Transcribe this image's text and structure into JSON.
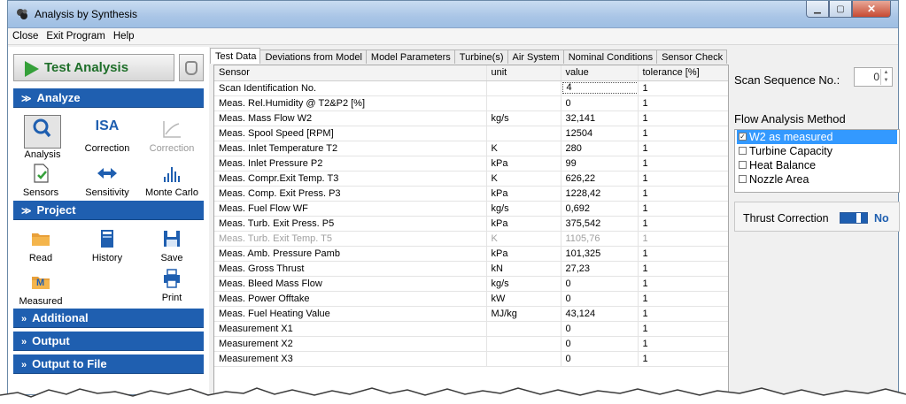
{
  "window": {
    "title": "Analysis by Synthesis",
    "controls": [
      "minimize",
      "maximize",
      "close"
    ]
  },
  "menu": [
    "Close",
    "Exit Program",
    "Help"
  ],
  "sidebar": {
    "run_button_label": "Test Analysis",
    "sections": {
      "analyze": "Analyze",
      "project": "Project",
      "additional": "Additional",
      "output": "Output",
      "output_file": "Output to File"
    },
    "analyze_tools": [
      {
        "label": "Analysis",
        "icon": "search-icon",
        "enabled": true,
        "selected": true
      },
      {
        "label": "Correction",
        "icon": "isa-icon",
        "icon_text": "ISA",
        "enabled": true
      },
      {
        "label": "Correction",
        "icon": "curve-icon",
        "enabled": false
      },
      {
        "label": "Sensors",
        "icon": "document-check-icon",
        "enabled": true
      },
      {
        "label": "Sensitivity",
        "icon": "double-arrow-icon",
        "enabled": true
      },
      {
        "label": "Monte Carlo",
        "icon": "histogram-icon",
        "enabled": true
      }
    ],
    "project_tools": [
      {
        "label": "Read",
        "icon": "folder-icon"
      },
      {
        "label": "History",
        "icon": "book-icon"
      },
      {
        "label": "Save",
        "icon": "floppy-icon"
      },
      {
        "label": "Measured",
        "icon": "measured-folder-icon",
        "icon_text": "M"
      },
      {
        "label": "Print",
        "icon": "printer-icon"
      }
    ]
  },
  "tabs": [
    "Test Data",
    "Deviations from Model",
    "Model Parameters",
    "Turbine(s)",
    "Air System",
    "Nominal Conditions",
    "Sensor Check"
  ],
  "active_tab": "Test Data",
  "table": {
    "headers": [
      "Sensor",
      "unit",
      "value",
      "tolerance [%]"
    ],
    "rows": [
      [
        "Scan Identification No.",
        "",
        "4",
        "1"
      ],
      [
        "Meas. Rel.Humidity @ T2&P2 [%]",
        "",
        "0",
        "1"
      ],
      [
        "Meas. Mass Flow W2",
        "kg/s",
        "32,141",
        "1"
      ],
      [
        "Meas. Spool Speed [RPM]",
        "",
        "12504",
        "1"
      ],
      [
        "Meas. Inlet Temperature T2",
        "K",
        "280",
        "1"
      ],
      [
        "Meas. Inlet Pressure P2",
        "kPa",
        "99",
        "1"
      ],
      [
        "Meas. Compr.Exit Temp. T3",
        "K",
        "626,22",
        "1"
      ],
      [
        "Meas. Comp. Exit Press. P3",
        "kPa",
        "1228,42",
        "1"
      ],
      [
        "Meas. Fuel Flow WF",
        "kg/s",
        "0,692",
        "1"
      ],
      [
        "Meas. Turb. Exit Press. P5",
        "kPa",
        "375,542",
        "1"
      ],
      [
        "Meas. Turb. Exit Temp. T5",
        "K",
        "1105,76",
        "1"
      ],
      [
        "Meas. Amb. Pressure Pamb",
        "kPa",
        "101,325",
        "1"
      ],
      [
        "Meas. Gross Thrust",
        "kN",
        "27,23",
        "1"
      ],
      [
        "Meas. Bleed Mass Flow",
        "kg/s",
        "0",
        "1"
      ],
      [
        "Meas. Power Offtake",
        "kW",
        "0",
        "1"
      ],
      [
        "Meas. Fuel Heating Value",
        "MJ/kg",
        "43,124",
        "1"
      ],
      [
        "Measurement X1",
        "",
        "0",
        "1"
      ],
      [
        "Measurement X2",
        "",
        "0",
        "1"
      ],
      [
        "Measurement X3",
        "",
        "0",
        "1"
      ]
    ],
    "dimmed_row_index": 10,
    "editing_row_index": 0
  },
  "scan_sequence": {
    "label": "Scan Sequence No.:",
    "value": "0"
  },
  "flow_method": {
    "title": "Flow Analysis Method",
    "options": [
      {
        "label": "W2 as measured",
        "checked": true,
        "selected": true
      },
      {
        "label": "Turbine Capacity",
        "checked": false,
        "selected": false
      },
      {
        "label": "Heat Balance",
        "checked": false,
        "selected": false
      },
      {
        "label": "Nozzle Area",
        "checked": false,
        "selected": false
      }
    ]
  },
  "thrust_correction": {
    "label": "Thrust Correction",
    "state_label": "No"
  },
  "colors": {
    "accent": "#1f5fb0",
    "selection": "#3399ff",
    "run_green": "#35a03a"
  }
}
